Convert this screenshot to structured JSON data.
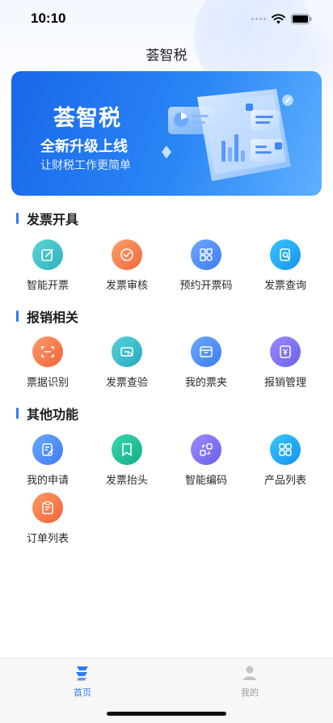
{
  "status_bar": {
    "time": "10:10",
    "icons": [
      "signal-icon",
      "wifi-icon",
      "battery-icon"
    ]
  },
  "nav": {
    "title": "荟智税"
  },
  "banner": {
    "title": "荟智税",
    "subtitle": "全新升级上线",
    "tagline": "让财税工作更简单"
  },
  "sections": {
    "invoice": {
      "title": "发票开具",
      "items": [
        {
          "label": "智能开票",
          "icon": "edit-icon",
          "color": "#3cc0c4"
        },
        {
          "label": "发票审核",
          "icon": "check-circle-icon",
          "color": "#f47c4e"
        },
        {
          "label": "预约开票码",
          "icon": "qrcode-icon",
          "color": "#4d8ef5"
        },
        {
          "label": "发票查询",
          "icon": "search-document-icon",
          "color": "#1aa3f0"
        }
      ]
    },
    "reimburse": {
      "title": "报销相关",
      "items": [
        {
          "label": "票据识别",
          "icon": "scan-icon",
          "color": "#f4794a"
        },
        {
          "label": "发票查验",
          "icon": "ticket-check-icon",
          "color": "#37bcc9"
        },
        {
          "label": "我的票夹",
          "icon": "folder-icon",
          "color": "#4c8ef4"
        },
        {
          "label": "报销管理",
          "icon": "yuan-icon",
          "color": "#7b72ee"
        }
      ]
    },
    "other": {
      "title": "其他功能",
      "items": [
        {
          "label": "我的申请",
          "icon": "application-icon",
          "color": "#4d8ef5"
        },
        {
          "label": "发票抬头",
          "icon": "bookmark-icon",
          "color": "#1fbf9a"
        },
        {
          "label": "智能编码",
          "icon": "code-icon",
          "color": "#7b72ee"
        },
        {
          "label": "产品列表",
          "icon": "grid-icon",
          "color": "#1aa3f0"
        },
        {
          "label": "订单列表",
          "icon": "clipboard-icon",
          "color": "#f47c4e"
        }
      ]
    }
  },
  "tab_bar": {
    "items": [
      {
        "label": "首页",
        "icon": "home-logo-icon",
        "active": true,
        "color": "#2f7cf6"
      },
      {
        "label": "我的",
        "icon": "user-icon",
        "active": false,
        "color": "#9a9a9a"
      }
    ]
  }
}
